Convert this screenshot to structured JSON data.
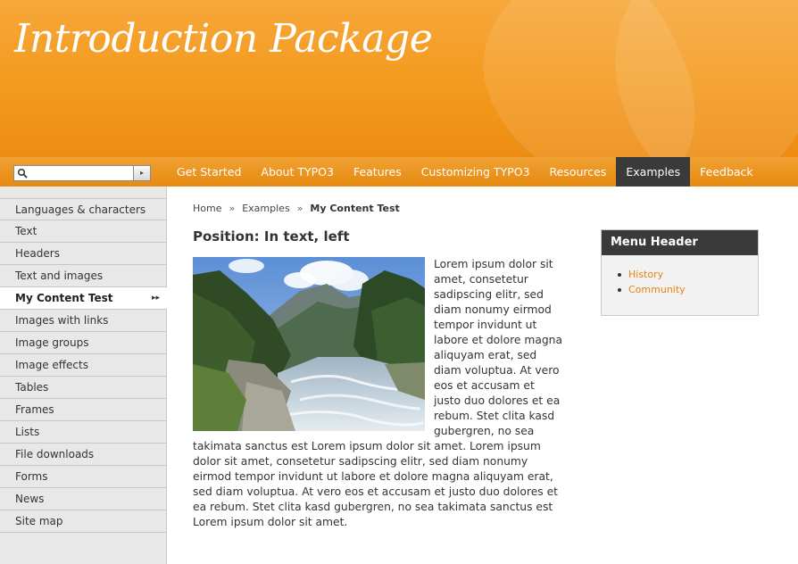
{
  "header": {
    "title": "Introduction Package"
  },
  "search": {
    "value": "",
    "go_symbol": "▸"
  },
  "nav": {
    "items": [
      {
        "label": "Get Started"
      },
      {
        "label": "About TYPO3"
      },
      {
        "label": "Features"
      },
      {
        "label": "Customizing TYPO3"
      },
      {
        "label": "Resources"
      },
      {
        "label": "Examples",
        "active": true
      },
      {
        "label": "Feedback"
      }
    ]
  },
  "sidebar": {
    "items": [
      {
        "label": "Languages & characters"
      },
      {
        "label": "Text"
      },
      {
        "label": "Headers"
      },
      {
        "label": "Text and images"
      },
      {
        "label": "My Content Test",
        "active": true
      },
      {
        "label": "Images with links"
      },
      {
        "label": "Image groups"
      },
      {
        "label": "Image effects"
      },
      {
        "label": "Tables"
      },
      {
        "label": "Frames"
      },
      {
        "label": "Lists"
      },
      {
        "label": "File downloads"
      },
      {
        "label": "Forms"
      },
      {
        "label": "News"
      },
      {
        "label": "Site map"
      }
    ],
    "active_marker": "▸▸"
  },
  "breadcrumb": {
    "home": "Home",
    "examples": "Examples",
    "current": "My Content Test",
    "separator": "»"
  },
  "main": {
    "heading": "Position: In text, left",
    "paragraph": "Lorem ipsum dolor sit amet, consetetur sadipscing elitr, sed diam nonumy eirmod tempor invidunt ut labore et dolore magna aliquyam erat, sed diam voluptua. At vero eos et accusam et justo duo dolores et ea rebum. Stet clita kasd gubergren, no sea takimata sanctus est Lorem ipsum dolor sit amet. Lorem ipsum dolor sit amet, consetetur sadipscing elitr, sed diam nonumy eirmod tempor invidunt ut labore et dolore magna aliquyam erat, sed diam voluptua. At vero eos et accusam et justo duo dolores et ea rebum. Stet clita kasd gubergren, no sea takimata sanctus est Lorem ipsum dolor sit amet."
  },
  "menu_box": {
    "header": "Menu Header",
    "links": [
      {
        "label": "History"
      },
      {
        "label": "Community"
      }
    ]
  },
  "colors": {
    "brand_orange": "#f39a1e",
    "nav_active": "#3a3a3a",
    "link_orange": "#e8830d"
  }
}
